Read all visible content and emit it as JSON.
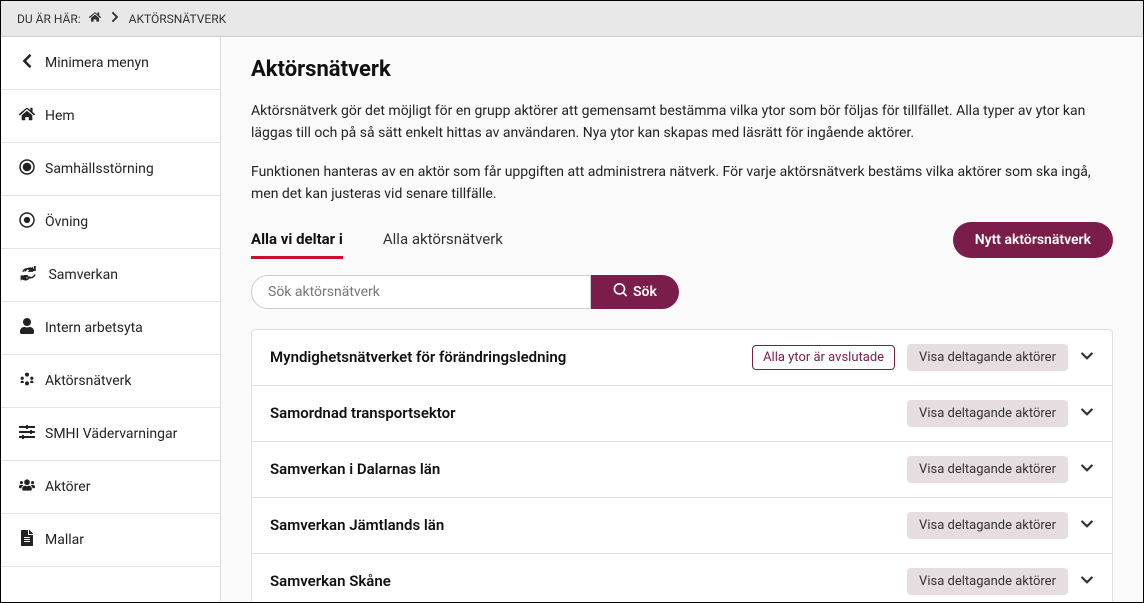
{
  "breadcrumb": {
    "prefix": "DU ÄR HÄR:",
    "current": "AKTÖRSNÄTVERK"
  },
  "sidebar": {
    "minimize": "Minimera menyn",
    "items": [
      {
        "label": "Hem"
      },
      {
        "label": "Samhällsstörning"
      },
      {
        "label": "Övning"
      },
      {
        "label": "Samverkan"
      },
      {
        "label": "Intern arbetsyta"
      },
      {
        "label": "Aktörsnätverk"
      },
      {
        "label": "SMHI Vädervarningar"
      },
      {
        "label": "Aktörer"
      },
      {
        "label": "Mallar"
      }
    ]
  },
  "page": {
    "title": "Aktörsnätverk",
    "paragraph1": "Aktörsnätverk gör det möjligt för en grupp aktörer att gemensamt bestämma vilka ytor som bör följas för tillfället. Alla typer av ytor kan läggas till och på så sätt enkelt hittas av användaren. Nya ytor kan skapas med läsrätt för ingående aktörer.",
    "paragraph2": "Funktionen hanteras av en aktör som får uppgiften att administrera nätverk. För varje aktörsnätverk bestäms vilka aktörer som ska ingå, men det kan justeras vid senare tillfälle."
  },
  "tabs": {
    "active": "Alla vi deltar i",
    "inactive": "Alla aktörsnätverk"
  },
  "actions": {
    "new_network": "Nytt aktörsnätverk",
    "search_placeholder": "Sök aktörsnätverk",
    "search_button": "Sök"
  },
  "networks": [
    {
      "name": "Myndighetsnätverket för förändringsledning",
      "closed_badge": "Alla ytor är avslutade",
      "view_actors": "Visa deltagande aktörer"
    },
    {
      "name": "Samordnad transportsektor",
      "closed_badge": "",
      "view_actors": "Visa deltagande aktörer"
    },
    {
      "name": "Samverkan i Dalarnas län",
      "closed_badge": "",
      "view_actors": "Visa deltagande aktörer"
    },
    {
      "name": "Samverkan Jämtlands län",
      "closed_badge": "",
      "view_actors": "Visa deltagande aktörer"
    },
    {
      "name": "Samverkan Skåne",
      "closed_badge": "",
      "view_actors": "Visa deltagande aktörer"
    }
  ]
}
